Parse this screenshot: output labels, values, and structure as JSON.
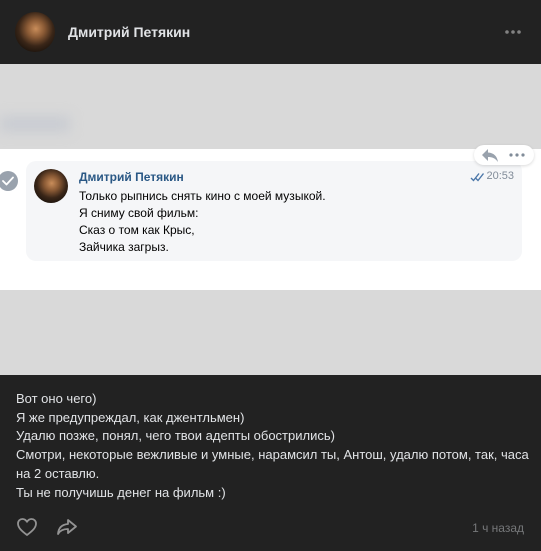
{
  "header": {
    "author": "Дмитрий Петякин",
    "avatar_icon": "user-avatar",
    "more_icon": "more-horizontal-icon"
  },
  "screenshot": {
    "message": {
      "author": "Дмитрий Петякин",
      "time": "20:53",
      "status_icon": "double-check-icon",
      "lines": [
        "Только рыпнись снять кино с моей музыкой.",
        "Я сниму свой фильм:",
        "Сказ о том как Крыс,",
        "Зайчика загрыз."
      ]
    },
    "actions": {
      "reply_icon": "reply-icon",
      "more_icon": "more-horizontal-icon"
    },
    "selected_icon": "check-circle-icon"
  },
  "post": {
    "lines": [
      "Вот оно чего)",
      "Я же предупреждал, как джентльмен)",
      "Удалю позже, понял, чего твои адепты обострились)",
      "Смотри, некоторые вежливые и умные, нарамсил ты, Антош, удалю потом, так, часа на 2 оставлю.",
      "Ты не получишь денег на фильм :)"
    ]
  },
  "footer": {
    "like_icon": "heart-icon",
    "share_icon": "share-icon",
    "timestamp": "1 ч назад"
  },
  "colors": {
    "background": "#222222",
    "text": "#e1e3e6",
    "link_blue": "#2a5885",
    "muted": "#76787a"
  }
}
